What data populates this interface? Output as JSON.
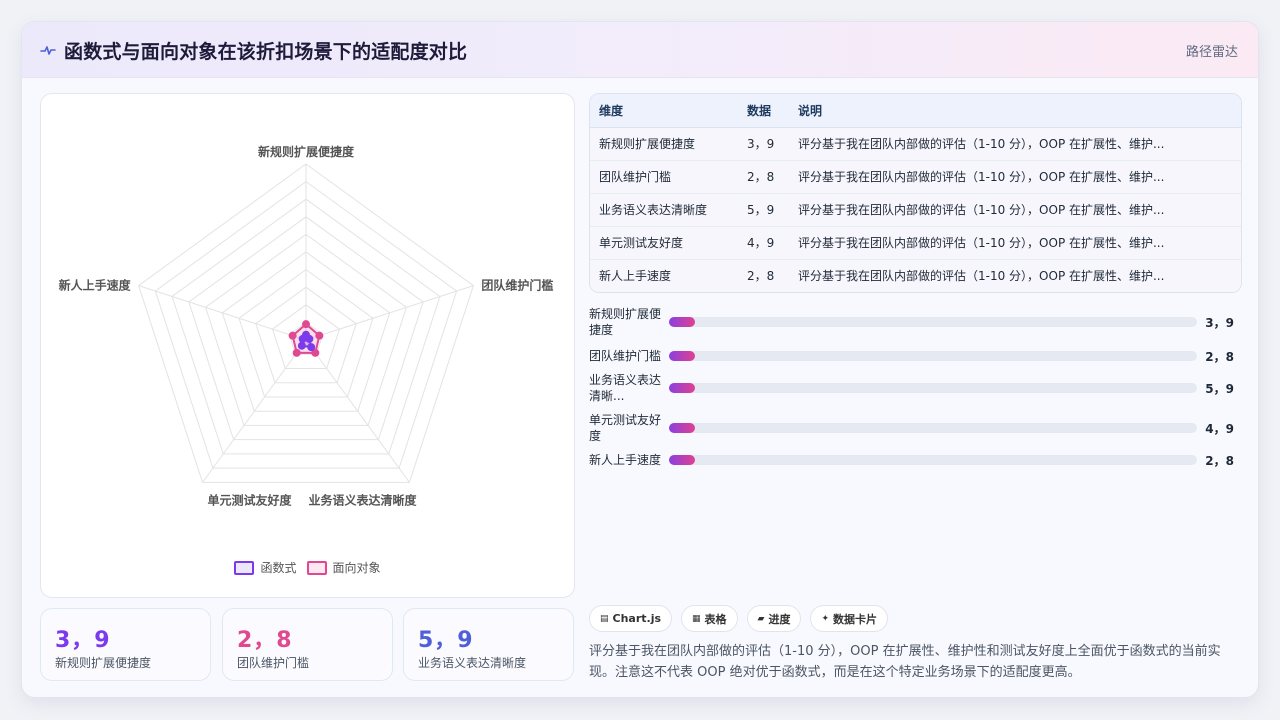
{
  "header": {
    "icon": "pulse-icon",
    "title": "函数式与面向对象在该折扣场景下的适配度对比",
    "tag": "路径雷达"
  },
  "colors": {
    "series_a": "#7c3aed",
    "series_b": "#e0488f",
    "accent_blue": "#4f5fd8"
  },
  "chart_data": {
    "type": "radar",
    "axes": [
      "新规则扩展便捷度",
      "团队维护门槛",
      "业务语义表达清晰度",
      "单元测试友好度",
      "新人上手速度"
    ],
    "series": [
      {
        "name": "函数式",
        "values": [
          3,
          2,
          5,
          4,
          2
        ]
      },
      {
        "name": "面向对象",
        "values": [
          9,
          8,
          9,
          9,
          8
        ]
      }
    ],
    "range": [
      0,
      100
    ],
    "rings": 10,
    "legend_position": "bottom"
  },
  "legend": [
    "函数式",
    "面向对象"
  ],
  "table": {
    "headers": [
      "维度",
      "数据",
      "说明"
    ],
    "rows": [
      {
        "dim": "新规则扩展便捷度",
        "data": "3，9",
        "desc": "评分基于我在团队内部做的评估（1-10 分），OOP 在扩展性、维护..."
      },
      {
        "dim": "团队维护门槛",
        "data": "2，8",
        "desc": "评分基于我在团队内部做的评估（1-10 分），OOP 在扩展性、维护..."
      },
      {
        "dim": "业务语义表达清晰度",
        "data": "5，9",
        "desc": "评分基于我在团队内部做的评估（1-10 分），OOP 在扩展性、维护..."
      },
      {
        "dim": "单元测试友好度",
        "data": "4，9",
        "desc": "评分基于我在团队内部做的评估（1-10 分），OOP 在扩展性、维护..."
      },
      {
        "dim": "新人上手速度",
        "data": "2，8",
        "desc": "评分基于我在团队内部做的评估（1-10 分），OOP 在扩展性、维护..."
      }
    ]
  },
  "bars": [
    {
      "label": "新规则扩展便捷度",
      "value": "3，9",
      "progress": 0.05
    },
    {
      "label": "团队维护门槛",
      "value": "2，8",
      "progress": 0.05
    },
    {
      "label": "业务语义表达清晰...",
      "value": "5，9",
      "progress": 0.05
    },
    {
      "label": "单元测试友好度",
      "value": "4，9",
      "progress": 0.05
    },
    {
      "label": "新人上手速度",
      "value": "2，8",
      "progress": 0.05
    }
  ],
  "stats": [
    {
      "value": "3，9",
      "label": "新规则扩展便捷度"
    },
    {
      "value": "2，8",
      "label": "团队维护门槛"
    },
    {
      "value": "5，9",
      "label": "业务语义表达清晰度"
    }
  ],
  "chips": [
    {
      "icon": "chart-icon",
      "label": "Chart.js"
    },
    {
      "icon": "table-icon",
      "label": "表格"
    },
    {
      "icon": "progress-icon",
      "label": "进度"
    },
    {
      "icon": "sparkle-icon",
      "label": "数据卡片"
    }
  ],
  "note": "评分基于我在团队内部做的评估（1-10 分），OOP 在扩展性、维护性和测试友好度上全面优于函数式的当前实现。注意这不代表 OOP 绝对优于函数式，而是在这个特定业务场景下的适配度更高。"
}
